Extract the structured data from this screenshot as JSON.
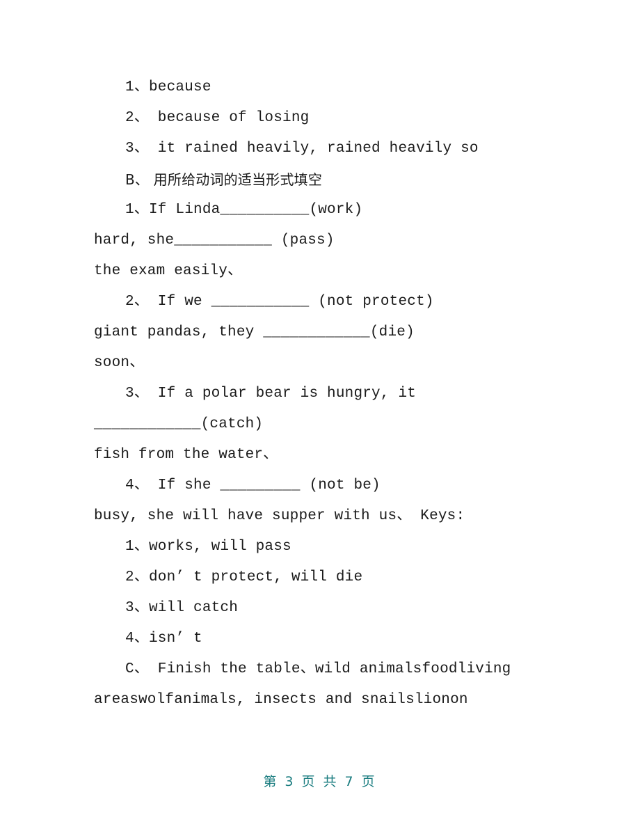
{
  "document": {
    "lines": [
      {
        "id": "ans-a-1",
        "text": "1、because",
        "indent": true
      },
      {
        "id": "ans-a-2",
        "text": "2、 because of losing",
        "indent": true
      },
      {
        "id": "ans-a-3",
        "text": "3、 it rained heavily, rained heavily so",
        "indent": true
      },
      {
        "id": "section-b",
        "text": "B、 用所给动词的适当形式填空",
        "indent": true,
        "cjk": true
      },
      {
        "id": "b-1a",
        "text": "1、If Linda__________(work)",
        "indent": true
      },
      {
        "id": "b-1b",
        "text": "hard, she___________ (pass)",
        "indent": false
      },
      {
        "id": "b-1c",
        "text": "the exam easily、",
        "indent": false
      },
      {
        "id": "b-2a",
        "text": "2、 If we ___________ (not protect)",
        "indent": true
      },
      {
        "id": "b-2b",
        "text": "giant pandas, they ____________(die)",
        "indent": false
      },
      {
        "id": "b-2c",
        "text": "soon、",
        "indent": false
      },
      {
        "id": "b-3a",
        "text": "3、 If a polar bear is hungry, it",
        "indent": true
      },
      {
        "id": "b-3b",
        "text": "____________(catch)",
        "indent": false
      },
      {
        "id": "b-3c",
        "text": "fish from the water、",
        "indent": false
      },
      {
        "id": "b-4a",
        "text": "4、 If she _________ (not be)",
        "indent": true
      },
      {
        "id": "b-4b",
        "text": "busy, she will have supper with us、 Keys:",
        "indent": false
      },
      {
        "id": "keys-1",
        "text": "1、works, will pass",
        "indent": true
      },
      {
        "id": "keys-2",
        "text": "2、don’ t protect, will die",
        "indent": true
      },
      {
        "id": "keys-3",
        "text": "3、will catch",
        "indent": true
      },
      {
        "id": "keys-4",
        "text": "4、isn’ t",
        "indent": true
      },
      {
        "id": "section-c",
        "text": "C、 Finish the table、wild animalsfoodliving",
        "indent": true
      },
      {
        "id": "section-c-2",
        "text": "areaswolfanimals, insects and snailslionon",
        "indent": false
      }
    ]
  },
  "footer": {
    "page_label": "第 3 页 共 7 页",
    "current_page": 3,
    "total_pages": 7,
    "color": "#1b7d80"
  },
  "colors": {
    "background": "#ffffff",
    "text": "#1a1a1a",
    "footer_text": "#1b7d80",
    "blank_rule": "#555555"
  }
}
